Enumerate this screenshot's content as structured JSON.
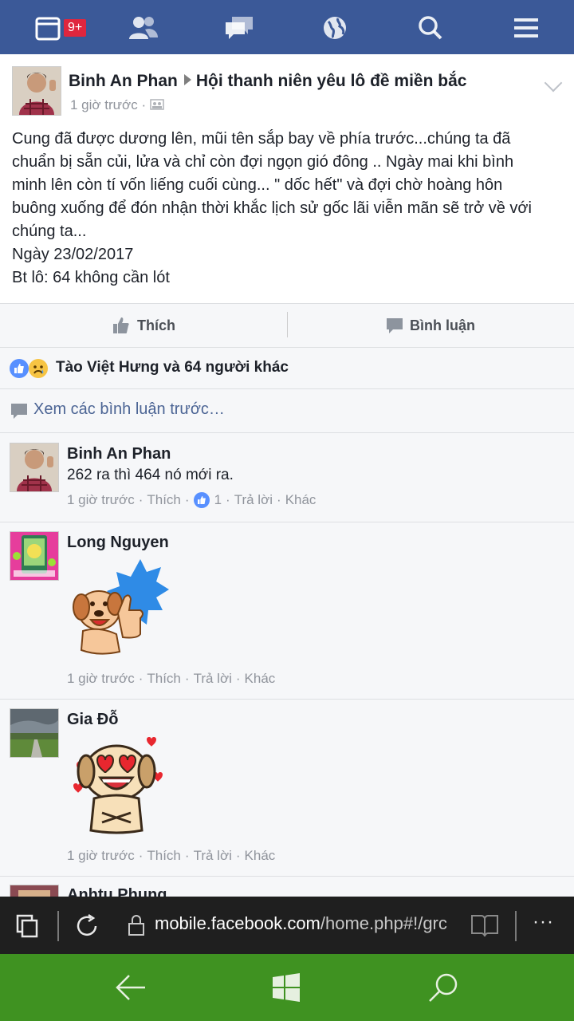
{
  "topbar": {
    "notification_count": "9+",
    "icons": [
      "notifications-icon",
      "friends-icon",
      "messages-icon",
      "globe-icon",
      "search-icon",
      "menu-icon"
    ]
  },
  "post": {
    "author": "Binh An Phan",
    "group": "Hội thanh niên yêu lô đề miền bắc",
    "time": "1 giờ trước",
    "time_separator": "·",
    "body_lines": [
      "Cung đã được dương lên, mũi tên sắp bay về phía trước...chúng ta đã",
      "chuẩn bị sẵn củi, lửa và chỉ còn đợi ngọn gió đông .. Ngày mai khi bình",
      "minh lên còn tí vốn liếng cuối cùng... \" dốc hết\" và đợi chờ hoàng hôn",
      "buông xuống để đón nhận thời khắc lịch sử gốc lãi viễn mãn sẽ trở về với",
      "chúng ta...",
      "Ngày 23/02/2017",
      "Bt lô: 64 không cần lót"
    ]
  },
  "actions": {
    "like_label": "Thích",
    "comment_label": "Bình luận"
  },
  "reactions": {
    "summary": "Tào Việt Hưng và 64 người khác"
  },
  "previous_comments_label": "Xem các bình luận trước…",
  "comments": [
    {
      "name": "Binh An Phan",
      "text": "262 ra thì 464 nó mới ra.",
      "time": "1 giờ trước",
      "like": "Thích",
      "like_count": "1",
      "reply": "Trả lời",
      "more": "Khác"
    },
    {
      "name": "Long Nguyen",
      "sticker": "dog-thumbs-up-sticker",
      "time": "1 giờ trước",
      "like": "Thích",
      "reply": "Trả lời",
      "more": "Khác"
    },
    {
      "name": "Gia Đỗ",
      "sticker": "dog-heart-eyes-sticker",
      "time": "1 giờ trước",
      "like": "Thích",
      "reply": "Trả lời",
      "more": "Khác"
    },
    {
      "name": "Anhtu Phung"
    }
  ],
  "browser": {
    "url_host": "mobile.facebook.com",
    "url_path": "/home.php#!/grc",
    "more_label": "···"
  },
  "colors": {
    "facebook_blue": "#3b5998",
    "badge_red": "#e0263e",
    "windows_green": "#3f9221",
    "link_blue": "#4b6494"
  }
}
